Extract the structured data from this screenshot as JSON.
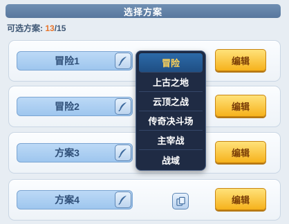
{
  "header": {
    "title": "选择方案"
  },
  "count": {
    "label": "可选方案: ",
    "current": "13",
    "total": "/15"
  },
  "plans": [
    {
      "name": "冒险1",
      "edit_label": "编辑"
    },
    {
      "name": "冒险2",
      "edit_label": "编辑"
    },
    {
      "name": "方案3",
      "edit_label": "编辑"
    },
    {
      "name": "方案4",
      "edit_label": "编辑"
    }
  ],
  "dropdown": {
    "selected": "冒险",
    "options": [
      "冒险",
      "上古之地",
      "云顶之战",
      "传奇决斗场",
      "主宰战",
      "战域"
    ]
  },
  "colors": {
    "accent_count": "#e8752a",
    "edit_button": "#f6b21c",
    "dropdown_bg": "#1f2b44",
    "selected_option_text": "#ffd257"
  }
}
